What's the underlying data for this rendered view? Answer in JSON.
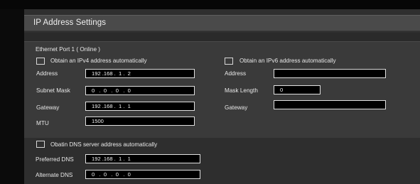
{
  "title": "IP Address Settings",
  "ethernet_port": "Ethernet Port 1 ( Online )",
  "ipv4": {
    "auto_label": "Obtain an IPv4 address automatically",
    "address_label": "Address",
    "address_value": "192 .168 .  1 .  2",
    "subnet_label": "Subnet Mask",
    "subnet_value": "0   .  0   .  0   .  0",
    "gateway_label": "Gateway",
    "gateway_value": "192 .168 .  1 .  1",
    "mtu_label": "MTU",
    "mtu_value": "1500"
  },
  "ipv6": {
    "auto_label": "Obtain an IPv6 address automatically",
    "address_label": "Address",
    "address_value": "",
    "mask_length_label": "Mask Length",
    "mask_length_value": "0",
    "gateway_label": "Gateway",
    "gateway_value": ""
  },
  "dns": {
    "auto_label": "Obatin DNS server address automatically",
    "preferred_label": "Preferred DNS",
    "preferred_value": "192 .168 .  1 .  1",
    "alternate_label": "Alternate DNS",
    "alternate_value": "0   .  0   .  0   .  0"
  }
}
